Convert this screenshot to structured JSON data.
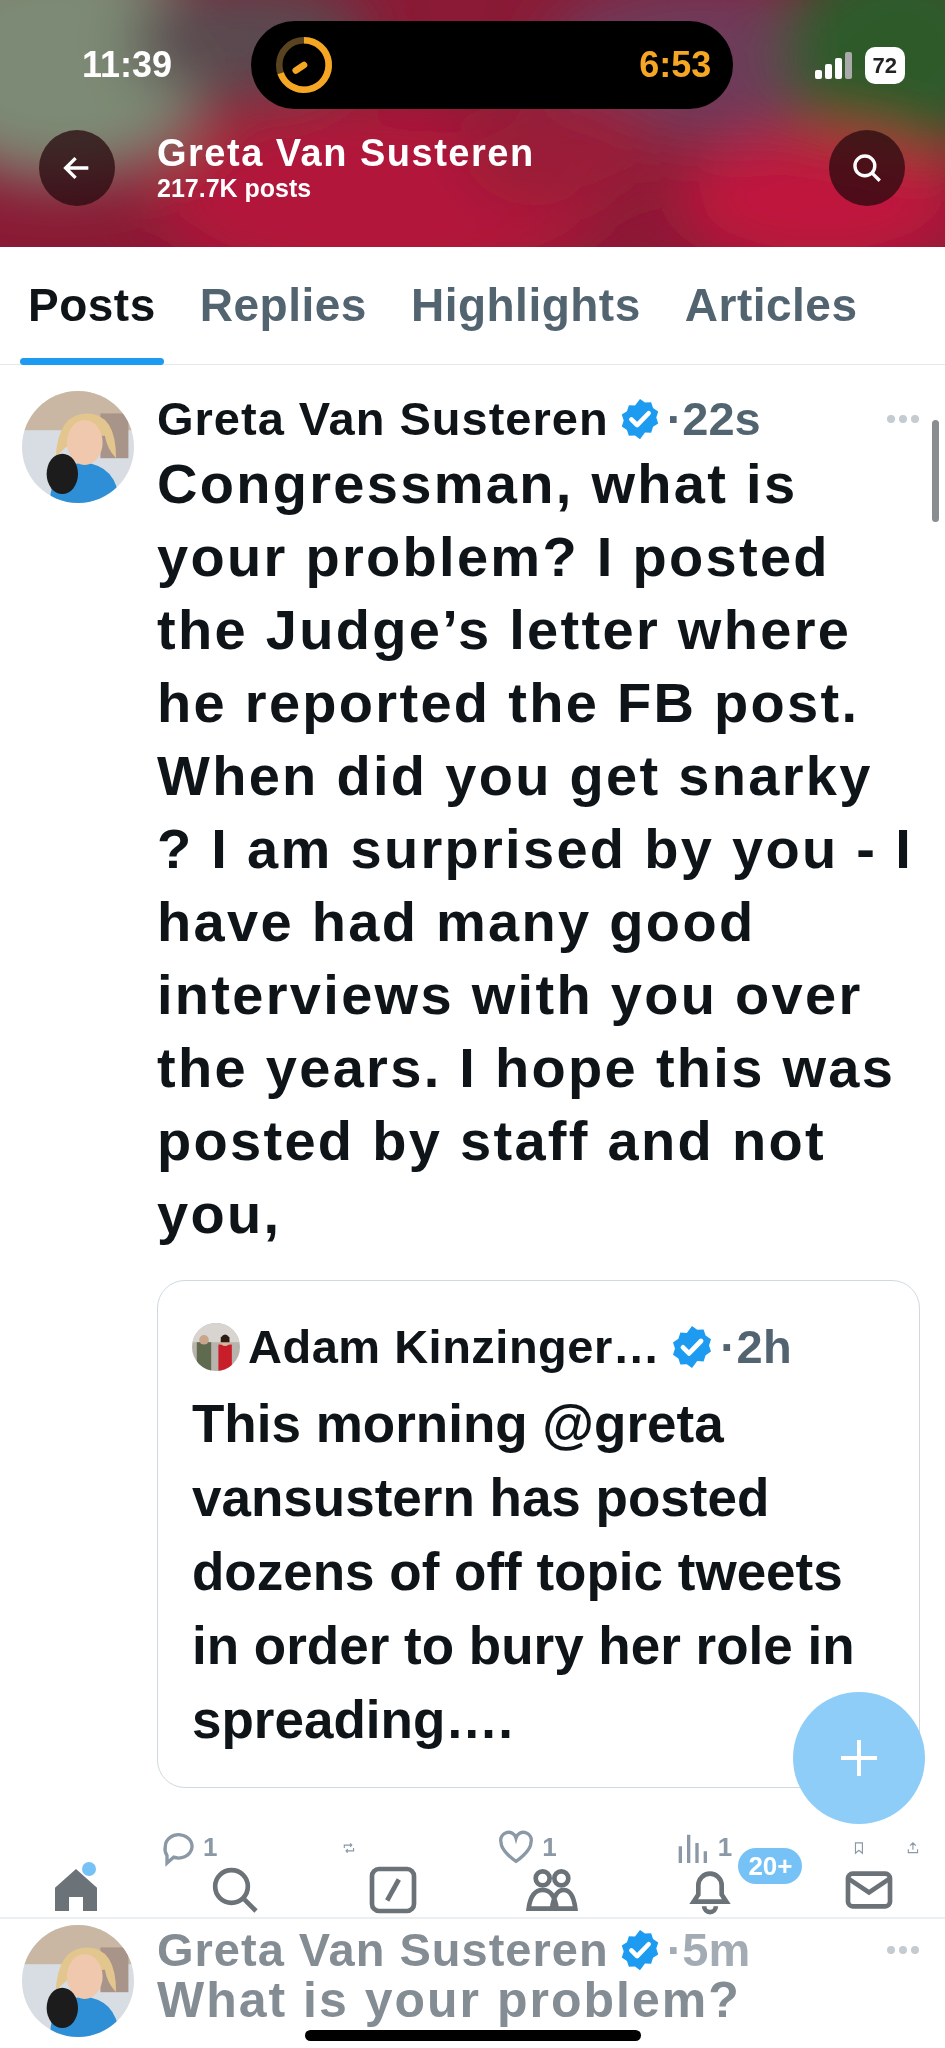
{
  "status_bar": {
    "time": "11:39",
    "timer": "6:53",
    "battery": "72"
  },
  "header": {
    "title": "Greta Van Susteren",
    "subtitle": "217.7K posts"
  },
  "tabs": [
    {
      "label": "Posts",
      "selected": true
    },
    {
      "label": "Replies",
      "selected": false
    },
    {
      "label": "Highlights",
      "selected": false
    },
    {
      "label": "Articles",
      "selected": false
    }
  ],
  "posts": [
    {
      "author": "Greta Van Susteren",
      "verified": true,
      "time": "·22s",
      "text": "Congressman, what is your problem? I posted the Judge’s letter where he reported the FB post. When did you get snarky ? I am surprised by you - I have had many good interviews with you over the years. I hope this was posted by staff and not you,",
      "quote": {
        "author": "Adam Kinzinger…",
        "verified": true,
        "time": "·2h",
        "text": "This morning @greta vansustern has posted dozens of off topic tweets in order to bury her role in spreading…."
      },
      "actions": [
        {
          "kind": "reply",
          "count": "1"
        },
        {
          "kind": "repost"
        },
        {
          "kind": "like",
          "count": "1"
        },
        {
          "kind": "views",
          "count": "1"
        },
        {
          "kind": "bookmark"
        },
        {
          "kind": "share"
        }
      ]
    },
    {
      "author": "Greta Van Susteren",
      "verified": true,
      "time": "·5m",
      "text": "What is your problem?"
    }
  ],
  "nav": [
    {
      "kind": "home",
      "selected": true,
      "unread": true
    },
    {
      "kind": "search",
      "selected": false,
      "unread": false
    },
    {
      "kind": "compose",
      "selected": false,
      "unread": false
    },
    {
      "kind": "communities",
      "selected": false,
      "unread": false
    },
    {
      "kind": "notifications",
      "selected": false,
      "unread": false,
      "badge": "20+"
    },
    {
      "kind": "messages",
      "selected": false,
      "unread": false
    }
  ]
}
